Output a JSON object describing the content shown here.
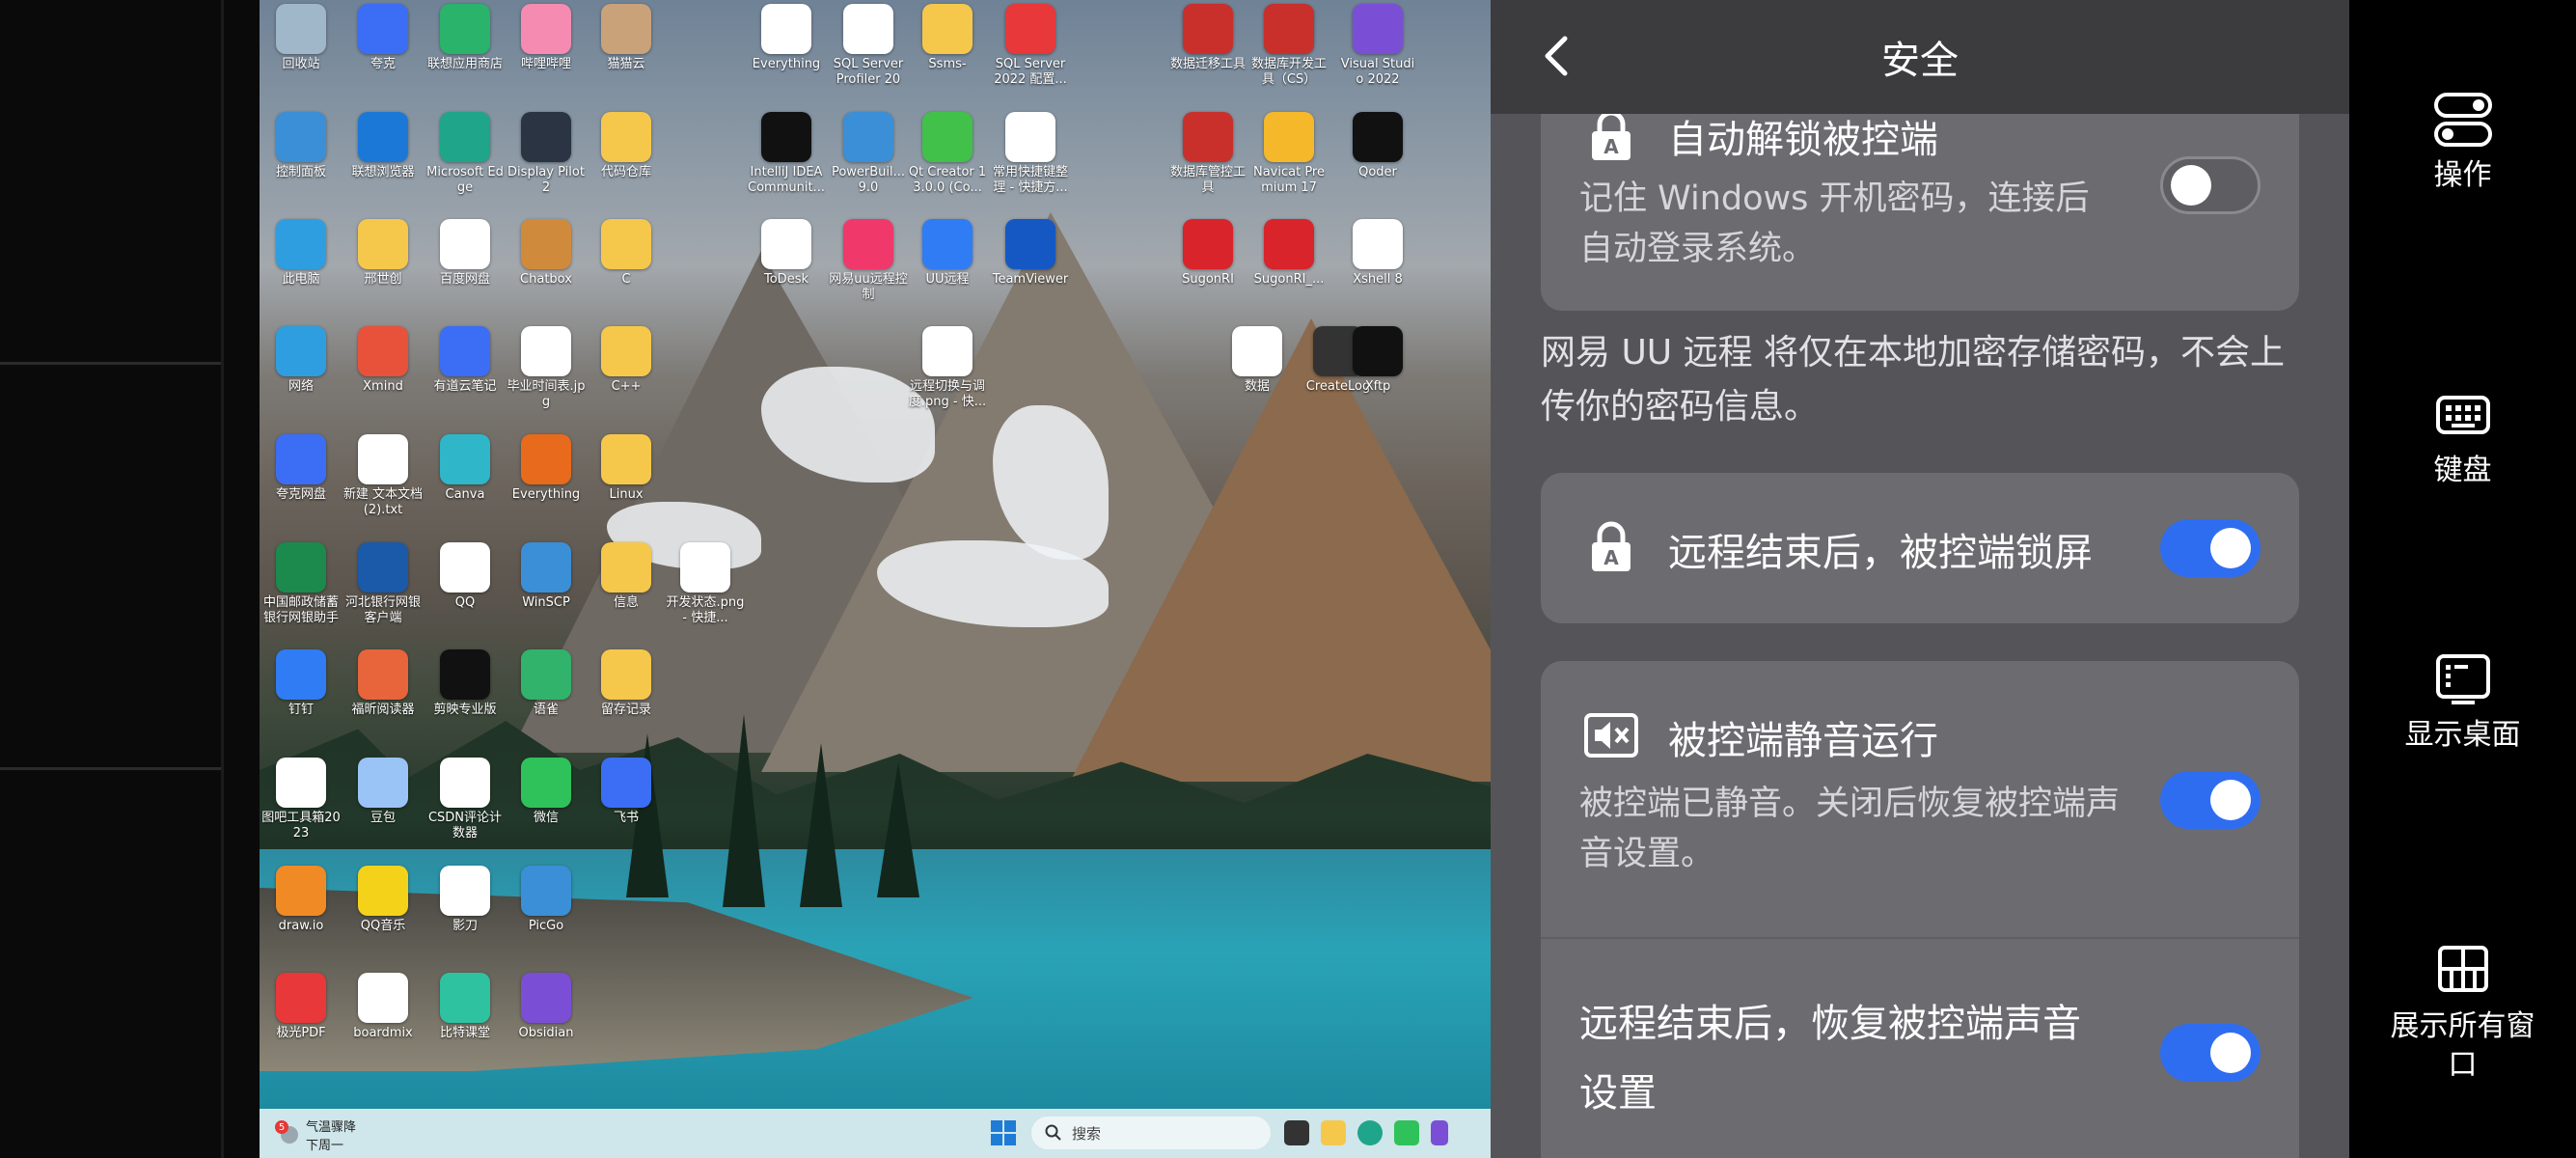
{
  "desktop": {
    "icons": [
      {
        "label": "回收站",
        "color": "#9fb7c9"
      },
      {
        "label": "夸克",
        "color": "#3b6ef5"
      },
      {
        "label": "联想应用商店",
        "color": "#29b36b"
      },
      {
        "label": "哔哩哔哩",
        "color": "#f58bb0"
      },
      {
        "label": "猫猫云",
        "color": "#c9a27a"
      },
      {
        "label": "控制面板",
        "color": "#3b8fd6"
      },
      {
        "label": "联想浏览器",
        "color": "#1b78d6"
      },
      {
        "label": "Microsoft Edge",
        "color": "#1ea58a"
      },
      {
        "label": "Display Pilot 2",
        "color": "#2a3442"
      },
      {
        "label": "代码仓库",
        "color": "#f5c84c"
      },
      {
        "label": "此电脑",
        "color": "#2f9ee0"
      },
      {
        "label": "邢世创",
        "color": "#f5c84c"
      },
      {
        "label": "百度网盘",
        "color": "#ffffff"
      },
      {
        "label": "Chatbox",
        "color": "#d08a3c"
      },
      {
        "label": "C",
        "color": "#f5c84c"
      },
      {
        "label": "网络",
        "color": "#2f9ee0"
      },
      {
        "label": "Xmind",
        "color": "#e8523a"
      },
      {
        "label": "有道云笔记",
        "color": "#3b6ef5"
      },
      {
        "label": "毕业时间表.jpg",
        "color": "#ffffff"
      },
      {
        "label": "C++",
        "color": "#f5c84c"
      },
      {
        "label": "夸克网盘",
        "color": "#3b6ef5"
      },
      {
        "label": "新建 文本文档 (2).txt",
        "color": "#ffffff"
      },
      {
        "label": "Canva",
        "color": "#2fb6c9"
      },
      {
        "label": "Everything",
        "color": "#e86a1c"
      },
      {
        "label": "Linux",
        "color": "#f5c84c"
      },
      {
        "label": "中国邮政储蓄银行网银助手",
        "color": "#1b8a4c"
      },
      {
        "label": "河北银行网银客户端",
        "color": "#1b5aa8"
      },
      {
        "label": "QQ",
        "color": "#ffffff"
      },
      {
        "label": "WinSCP",
        "color": "#3b8fd6"
      },
      {
        "label": "信息",
        "color": "#f5c84c"
      },
      {
        "label": "钉钉",
        "color": "#2f7cf5"
      },
      {
        "label": "福昕阅读器",
        "color": "#e8643a"
      },
      {
        "label": "剪映专业版",
        "color": "#111111"
      },
      {
        "label": "语雀",
        "color": "#31b36b"
      },
      {
        "label": "留存记录",
        "color": "#f5c84c"
      },
      {
        "label": "图吧工具箱2023",
        "color": "#ffffff"
      },
      {
        "label": "豆包",
        "color": "#9ac4f5"
      },
      {
        "label": "CSDN评论计数器",
        "color": "#ffffff"
      },
      {
        "label": "微信",
        "color": "#2fc25b"
      },
      {
        "label": "飞书",
        "color": "#3b6ef5"
      },
      {
        "label": "draw.io",
        "color": "#f08a24"
      },
      {
        "label": "QQ音乐",
        "color": "#f5d21a"
      },
      {
        "label": "影刀",
        "color": "#ffffff"
      },
      {
        "label": "PicGo",
        "color": "#3b8fd6"
      },
      {
        "label": "极光PDF",
        "color": "#e8383a"
      },
      {
        "label": "boardmix",
        "color": "#ffffff"
      },
      {
        "label": "比特课堂",
        "color": "#2fc2a0"
      },
      {
        "label": "Obsidian",
        "color": "#7a4fd6"
      },
      {
        "label": "Everything",
        "color": "#ffffff"
      },
      {
        "label": "SQL Server Profiler 20",
        "color": "#ffffff"
      },
      {
        "label": "Ssms-",
        "color": "#f5c84c"
      },
      {
        "label": "SQL Server 2022 配置...",
        "color": "#e8383a"
      },
      {
        "label": "IntelliJ IDEA Communit...",
        "color": "#111111"
      },
      {
        "label": "PowerBuil... 9.0",
        "color": "#3b8fd6"
      },
      {
        "label": "Qt Creator 13.0.0 (Co...",
        "color": "#41c04a"
      },
      {
        "label": "常用快捷键整理 - 快捷方...",
        "color": "#ffffff"
      },
      {
        "label": "ToDesk",
        "color": "#ffffff"
      },
      {
        "label": "网易uu远程控制",
        "color": "#f0386b"
      },
      {
        "label": "UU远程",
        "color": "#2f7cf5"
      },
      {
        "label": "TeamViewer",
        "color": "#1558c4"
      },
      {
        "label": "远程切换与调度.png - 快...",
        "color": "#ffffff"
      },
      {
        "label": "数据",
        "color": "#ffffff"
      },
      {
        "label": "CreateLog",
        "color": "#333333"
      },
      {
        "label": "开发状态.png - 快捷...",
        "color": "#ffffff"
      },
      {
        "label": "数据迁移工具",
        "color": "#c9302c"
      },
      {
        "label": "数据库开发工具（CS）",
        "color": "#c9302c"
      },
      {
        "label": "数据库管控工具",
        "color": "#c9302c"
      },
      {
        "label": "Navicat Premium 17",
        "color": "#f5b82a"
      },
      {
        "label": "SugonRI",
        "color": "#d8242a"
      },
      {
        "label": "SugonRI_...",
        "color": "#d8242a"
      },
      {
        "label": "Visual Studio 2022",
        "color": "#7a4fd6"
      },
      {
        "label": "Qoder",
        "color": "#111111"
      },
      {
        "label": "Xshell 8",
        "color": "#ffffff"
      },
      {
        "label": "Xftp",
        "color": "#111111"
      }
    ],
    "taskbar": {
      "weather_badge": "5",
      "weather_title": "气温骤降",
      "weather_sub": "下周一",
      "search_placeholder": "搜索"
    }
  },
  "panel": {
    "title": "安全",
    "items": [
      {
        "title": "自动解锁被控端",
        "desc": "记住 Windows 开机密码，连接后自动登录系统。",
        "on": false
      },
      {
        "title": "远程结束后，被控端锁屏",
        "desc": "",
        "on": true
      },
      {
        "title": "被控端静音运行",
        "desc": "被控端已静音。关闭后恢复被控端声音设置。",
        "on": true
      },
      {
        "title": "远程结束后，恢复被控端声音设置",
        "desc": "",
        "on": true
      }
    ],
    "note": "网易 UU 远程 将仅在本地加密存储密码，不会上传你的密码信息。"
  },
  "toolbar": {
    "items": [
      {
        "label": "操作",
        "icon": "toggle-switch-icon"
      },
      {
        "label": "键盘",
        "icon": "keyboard-icon"
      },
      {
        "label": "显示桌面",
        "icon": "show-desktop-icon"
      },
      {
        "label": "展示所有窗口",
        "icon": "grid-windows-icon"
      }
    ]
  },
  "colors": {
    "accent": "#2f6df0",
    "panel_bg": "#58585c",
    "card_bg": "#6b6b70"
  }
}
